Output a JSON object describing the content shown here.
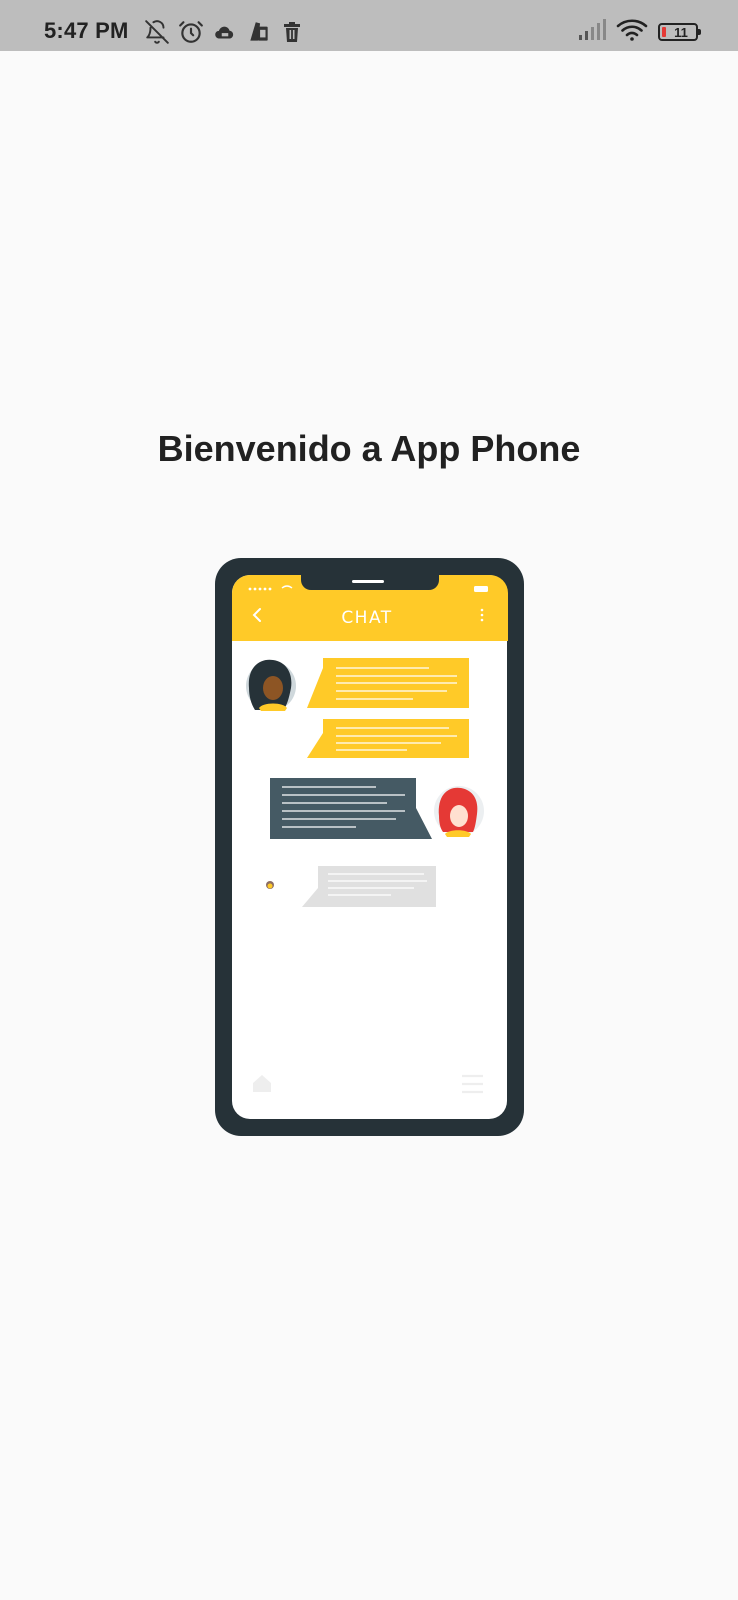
{
  "status_bar": {
    "time": "5:47 PM",
    "battery_level": "11",
    "icons": [
      "bell-off-icon",
      "alarm-icon",
      "cloud-app-icon",
      "bag-app-icon",
      "trash-icon",
      "signal-icon",
      "wifi-icon",
      "battery-icon"
    ]
  },
  "main": {
    "title": "Bienvenido a App Phone"
  },
  "illustration": {
    "header_title": "CHAT"
  },
  "colors": {
    "background": "#fafafa",
    "status_bar": "#bdbdbd",
    "accent_yellow": "#ffca28",
    "phone_frame": "#263238",
    "dark_bubble": "#455a64",
    "light_bubble": "#e0e0e0"
  }
}
